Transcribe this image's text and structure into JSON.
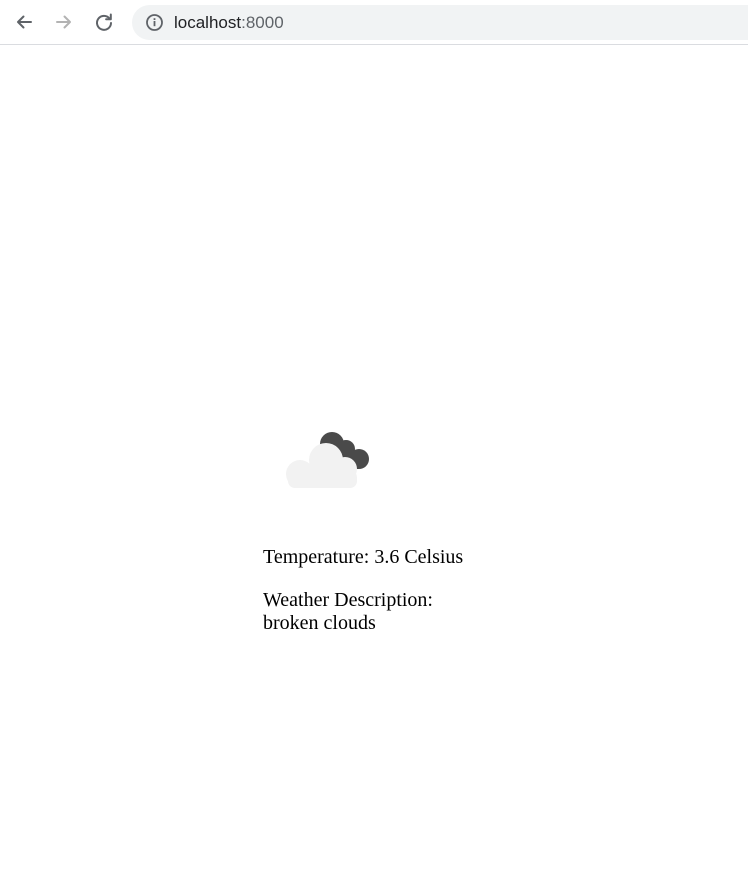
{
  "browser": {
    "url_host": "localhost",
    "url_port": ":8000",
    "back_icon": "arrow-left-icon",
    "forward_icon": "arrow-right-icon",
    "reload_icon": "reload-icon",
    "info_icon": "info-circle-icon"
  },
  "weather": {
    "icon": "broken-clouds-icon",
    "temperature_text": "Temperature: 3.6 Celsius",
    "description_label": "Weather Description:",
    "description_value": "broken clouds"
  },
  "colors": {
    "cloud_front": "#f2f2f2",
    "cloud_back": "#4a4a4a",
    "omnibox_bg": "#f1f3f4"
  }
}
